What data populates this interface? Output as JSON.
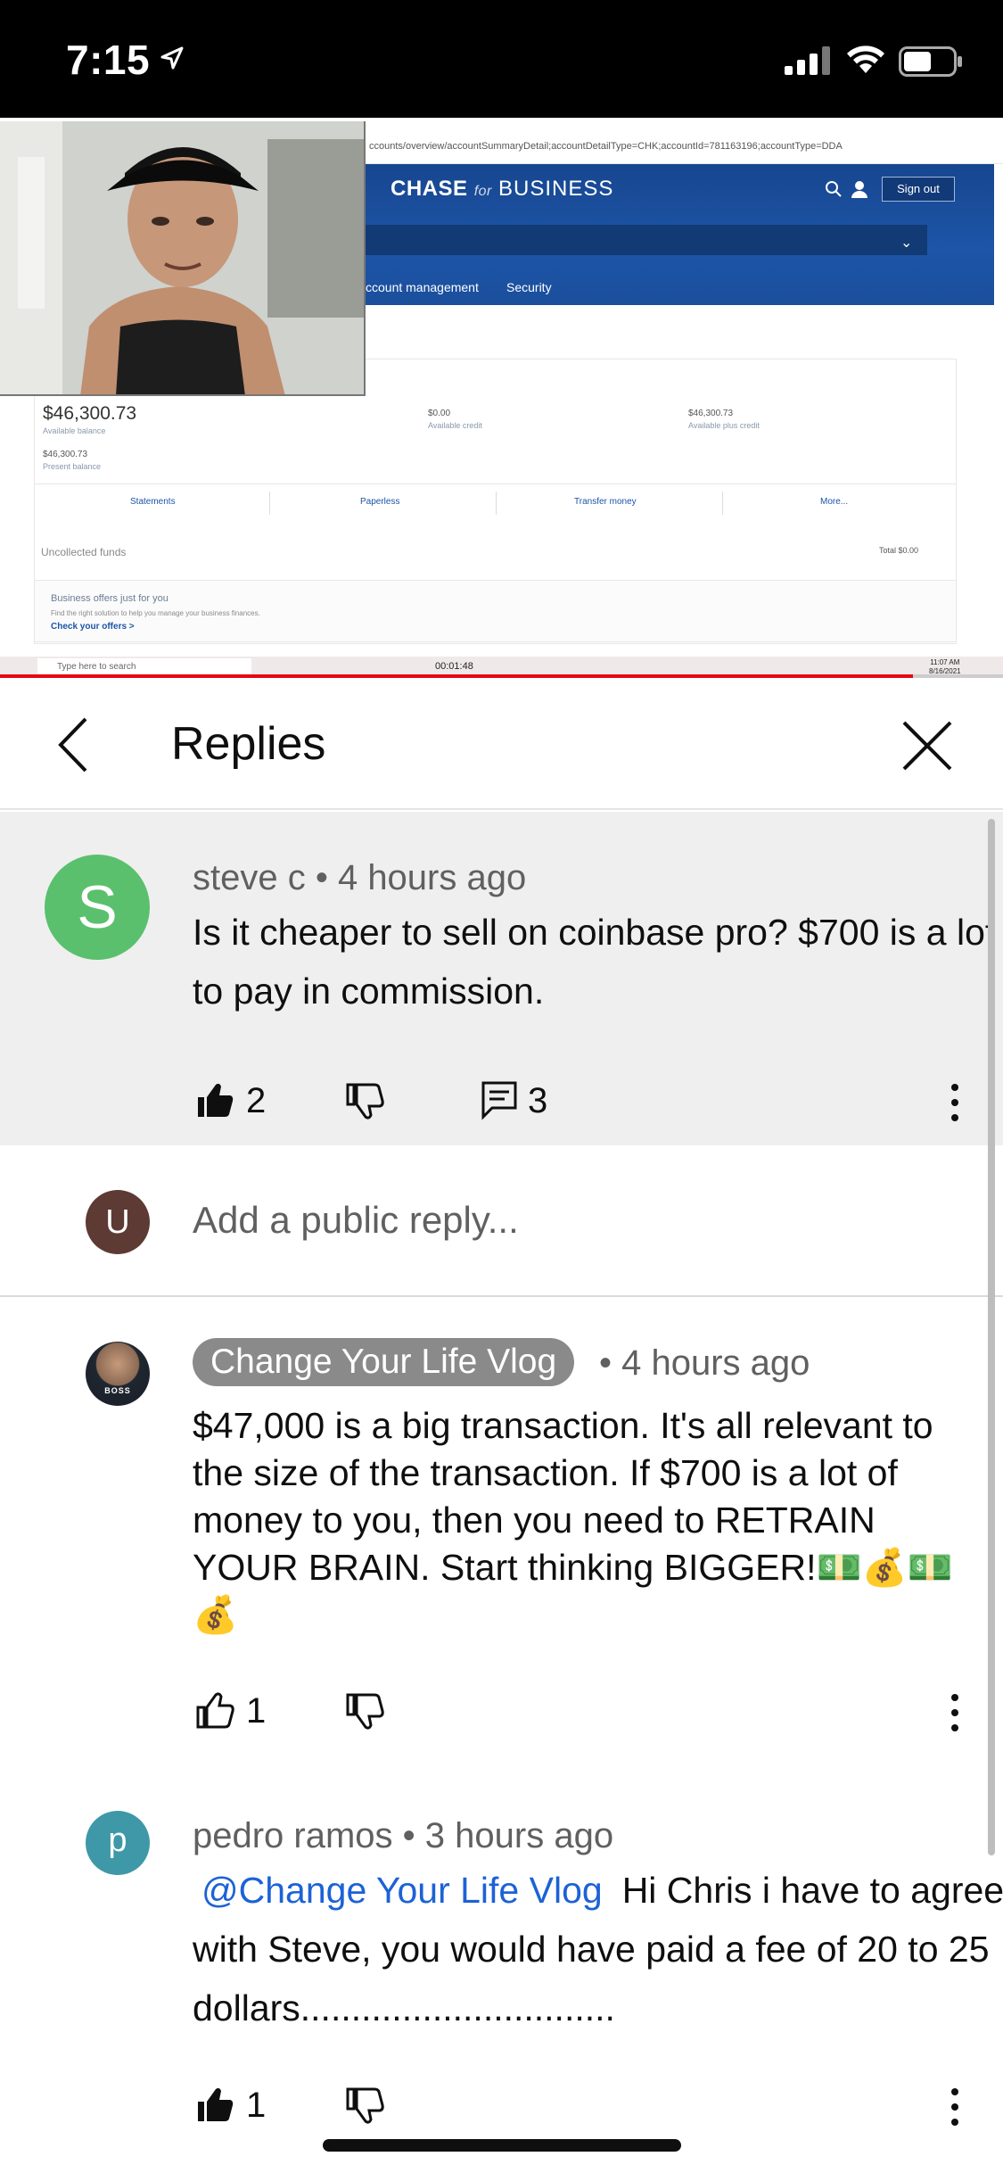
{
  "status_bar": {
    "time": "7:15"
  },
  "video": {
    "browser_url": "ccounts/overview/accountSummaryDetail;accountDetailType=CHK;accountId=781163196;accountType=DDA",
    "chase_logo": {
      "chase": "CHASE",
      "for": "for",
      "business": "BUSINESS"
    },
    "sign_out": "Sign out",
    "nav": [
      "ccount management",
      "Security"
    ],
    "balance": "$46,300.73",
    "available_balance_label": "Available balance",
    "present_balance": "$46,300.73",
    "present_balance_label": "Present balance",
    "available_credit": "$0.00",
    "available_credit_label": "Available credit",
    "available_plus_credit": "$46,300.73",
    "available_plus_credit_label": "Available plus credit",
    "links": [
      "Statements",
      "Paperless",
      "Transfer money",
      "More..."
    ],
    "uncollected_funds": "Uncollected funds",
    "total_label": "Total $0.00",
    "offers_title": "Business offers just for you",
    "offers_sub": "Find the right solution to help you manage your business finances.",
    "offers_link": "Check your offers >",
    "taskbar_search": "Type here to search",
    "recording_timer": "00:01:48",
    "clock_time": "11:07 AM",
    "clock_date": "8/16/2021",
    "progress": 0.91
  },
  "replies_header": {
    "title": "Replies"
  },
  "parent_comment": {
    "author": "steve c",
    "time": "4 hours ago",
    "text": "Is it cheaper to sell on coinbase pro? $700 is a lot to pay in commission.",
    "likes": "2",
    "replies": "3",
    "avatar_letter": "S",
    "avatar_color": "#5ac06d"
  },
  "reply_box": {
    "avatar_letter": "U",
    "placeholder": "Add a public reply..."
  },
  "replies": [
    {
      "author": "Change Your Life Vlog",
      "time": "4 hours ago",
      "text": "$47,000 is a big transaction. It's all relevant to the size of the transaction. If $700 is a lot of money to you, then you need to RETRAIN YOUR BRAIN. Start thinking BIGGER!💵💰💵💰",
      "likes": "1",
      "avatar_text": "BOSS"
    },
    {
      "author": "pedro ramos",
      "time": "3 hours ago",
      "mention": "@Change Your Life Vlog",
      "text": "Hi Chris i have to agree with Steve, you would have paid a fee of 20 to 25 dollars...............................",
      "likes": "1",
      "avatar_letter": "p",
      "avatar_color": "#3e98a8"
    }
  ]
}
